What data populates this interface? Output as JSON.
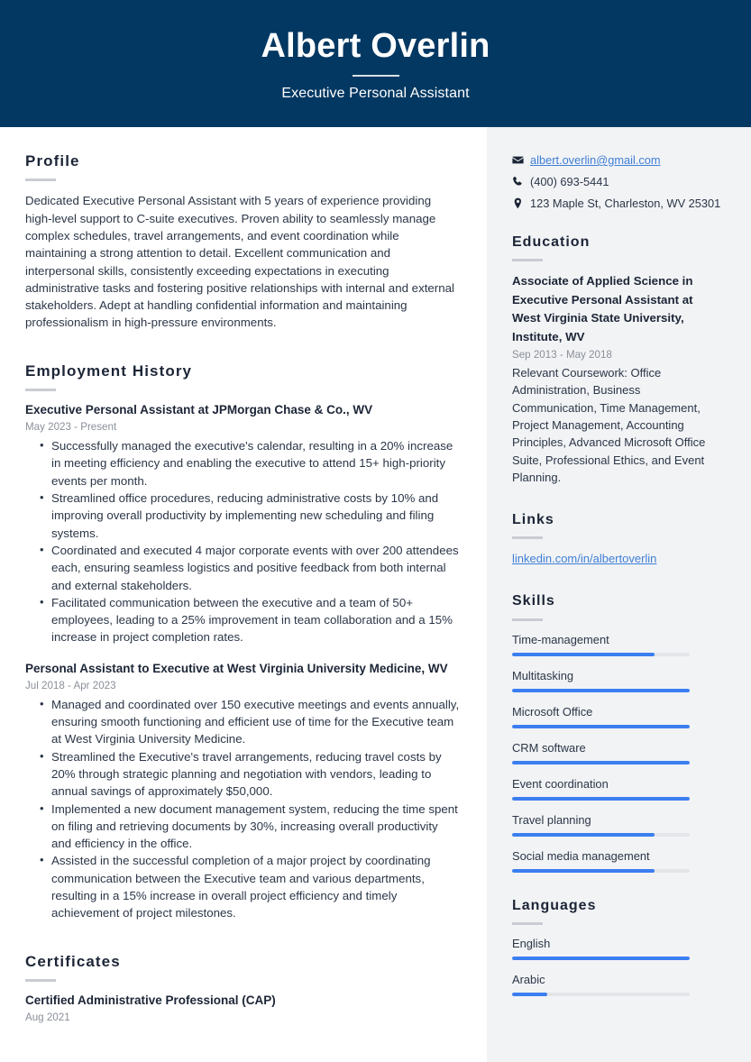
{
  "header": {
    "full_name": "Albert Overlin",
    "job_title": "Executive Personal Assistant",
    "background_color": "#033862"
  },
  "main": {
    "profile": {
      "heading": "Profile",
      "text": "Dedicated Executive Personal Assistant with 5 years of experience providing high-level support to C-suite executives. Proven ability to seamlessly manage complex schedules, travel arrangements, and event coordination while maintaining a strong attention to detail. Excellent communication and interpersonal skills, consistently exceeding expectations in executing administrative tasks and fostering positive relationships with internal and external stakeholders. Adept at handling confidential information and maintaining professionalism in high-pressure environments."
    },
    "employment": {
      "heading": "Employment History",
      "entries": [
        {
          "title": "Executive Personal Assistant at JPMorgan Chase & Co., WV",
          "date": "May 2023 - Present",
          "bullets": [
            "Successfully managed the executive's calendar, resulting in a 20% increase in meeting efficiency and enabling the executive to attend 15+ high-priority events per month.",
            "Streamlined office procedures, reducing administrative costs by 10% and improving overall productivity by implementing new scheduling and filing systems.",
            "Coordinated and executed 4 major corporate events with over 200 attendees each, ensuring seamless logistics and positive feedback from both internal and external stakeholders.",
            "Facilitated communication between the executive and a team of 50+ employees, leading to a 25% improvement in team collaboration and a 15% increase in project completion rates."
          ]
        },
        {
          "title": "Personal Assistant to Executive at West Virginia University Medicine, WV",
          "date": "Jul 2018 - Apr 2023",
          "bullets": [
            "Managed and coordinated over 150 executive meetings and events annually, ensuring smooth functioning and efficient use of time for the Executive team at West Virginia University Medicine.",
            "Streamlined the Executive's travel arrangements, reducing travel costs by 20% through strategic planning and negotiation with vendors, leading to annual savings of approximately $50,000.",
            "Implemented a new document management system, reducing the time spent on filing and retrieving documents by 30%, increasing overall productivity and efficiency in the office.",
            "Assisted in the successful completion of a major project by coordinating communication between the Executive team and various departments, resulting in a 15% increase in overall project efficiency and timely achievement of project milestones."
          ]
        }
      ]
    },
    "certificates": {
      "heading": "Certificates",
      "entries": [
        {
          "title": "Certified Administrative Professional (CAP)",
          "date": "Aug 2021"
        }
      ]
    }
  },
  "sidebar": {
    "contact": [
      {
        "icon": "envelope-icon",
        "text": "albert.overlin@gmail.com",
        "is_link": true
      },
      {
        "icon": "phone-icon",
        "text": "(400) 693-5441",
        "is_link": false
      },
      {
        "icon": "location-pin-icon",
        "text": "123 Maple St, Charleston, WV 25301",
        "is_link": false
      }
    ],
    "education": {
      "heading": "Education",
      "degree": "Associate of Applied Science in Executive Personal Assistant at West Virginia State University, Institute, WV",
      "date": "Sep 2013 - May 2018",
      "description": "Relevant Coursework: Office Administration, Business Communication, Time Management, Project Management, Accounting Principles, Advanced Microsoft Office Suite, Professional Ethics, and Event Planning."
    },
    "links": {
      "heading": "Links",
      "items": [
        {
          "label": "linkedin.com/in/albertoverlin"
        }
      ]
    },
    "skills": {
      "heading": "Skills",
      "items": [
        {
          "label": "Time-management",
          "level": 80
        },
        {
          "label": "Multitasking",
          "level": 100
        },
        {
          "label": "Microsoft Office",
          "level": 100
        },
        {
          "label": "CRM software",
          "level": 100
        },
        {
          "label": "Event coordination",
          "level": 100
        },
        {
          "label": "Travel planning",
          "level": 80
        },
        {
          "label": "Social media management",
          "level": 80
        }
      ]
    },
    "languages": {
      "heading": "Languages",
      "items": [
        {
          "label": "English",
          "level": 100
        },
        {
          "label": "Arabic",
          "level": 20
        }
      ]
    },
    "accent_color": "#3b7ef0",
    "link_color": "#3f7fd6",
    "background_color": "#f2f3f5"
  }
}
